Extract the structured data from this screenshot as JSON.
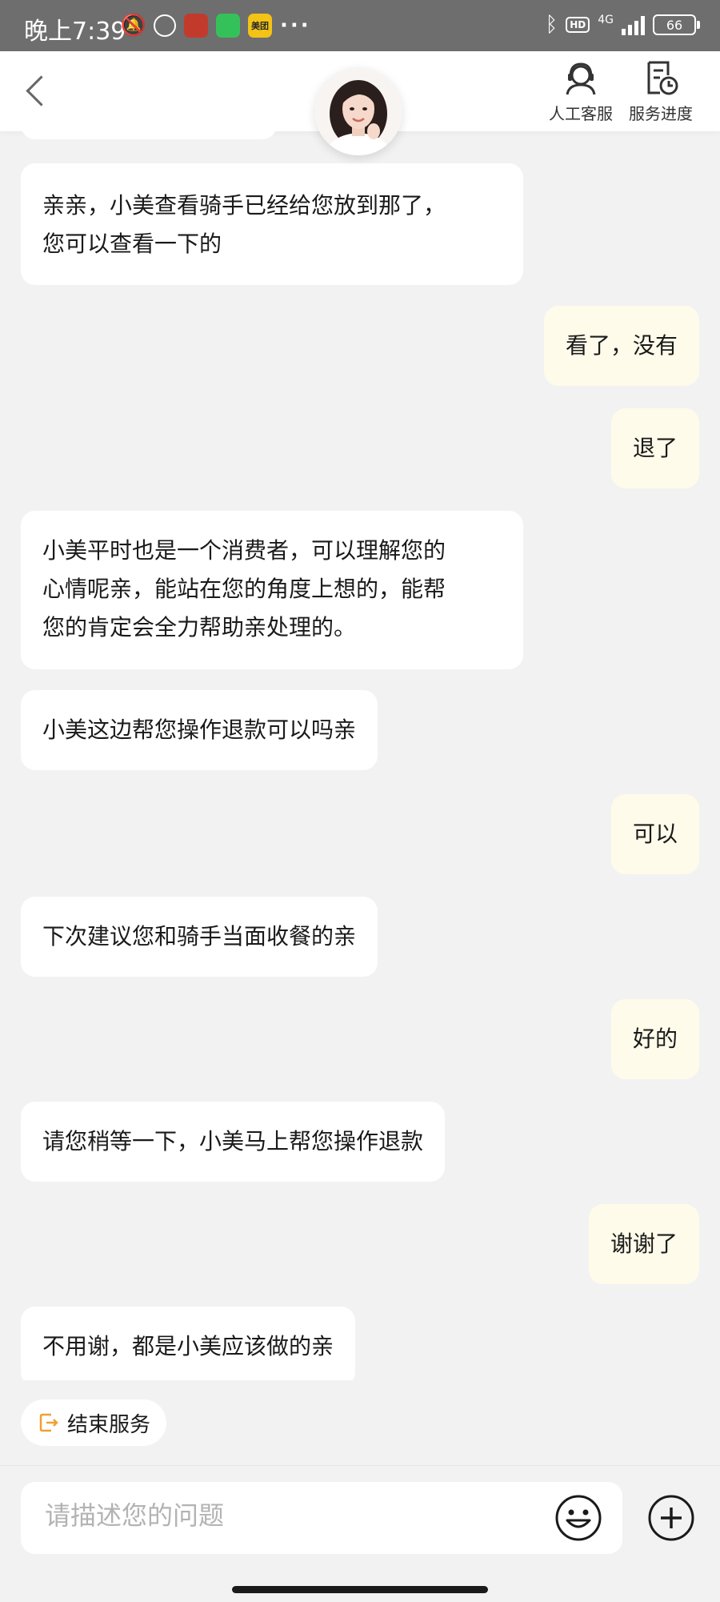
{
  "status_bar": {
    "time": "晚上7:39",
    "mt_label": "美团",
    "more": "···",
    "network": "4G",
    "battery": "66"
  },
  "header": {
    "human_service_label": "人工客服",
    "service_progress_label": "服务进度"
  },
  "messages": [
    {
      "from": "agent",
      "text": "亲亲，小美查看骑手已经给您放到那了，\n您可以查看一下的"
    },
    {
      "from": "user",
      "text": "看了，没有"
    },
    {
      "from": "user",
      "text": "退了"
    },
    {
      "from": "agent",
      "text": "小美平时也是一个消费者，可以理解您的\n心情呢亲，能站在您的角度上想的，能帮\n您的肯定会全力帮助亲处理的。"
    },
    {
      "from": "agent",
      "text": "小美这边帮您操作退款可以吗亲"
    },
    {
      "from": "user",
      "text": "可以"
    },
    {
      "from": "agent",
      "text": "下次建议您和骑手当面收餐的亲"
    },
    {
      "from": "user",
      "text": "好的"
    },
    {
      "from": "agent",
      "text": "请您稍等一下，小美马上帮您操作退款"
    },
    {
      "from": "user",
      "text": "谢谢了"
    },
    {
      "from": "agent",
      "text": "不用谢，都是小美应该做的亲"
    }
  ],
  "end_service_label": "结束服务",
  "input": {
    "placeholder": "请描述您的问题",
    "value": ""
  },
  "colors": {
    "agent_bubble": "#ffffff",
    "user_bubble": "#fffbea",
    "background": "#f2f2f2",
    "accent": "#f0a030"
  }
}
